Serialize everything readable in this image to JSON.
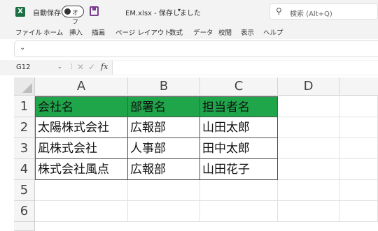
{
  "titlebar": {
    "app_icon": "excel-logo-icon",
    "app_icon_letter": "X",
    "autosave_label": "自動保存",
    "autosave_state": "オフ",
    "save_icon": "save-icon",
    "document_title": "EM.xlsx - 保存しました",
    "title_caret": "▾",
    "search_icon": "magnifier-icon",
    "search_glyph": "⚲",
    "search_placeholder": "検索 (Alt+Q)"
  },
  "menu": {
    "items": [
      "ファイル",
      "ホーム",
      "挿入",
      "描画",
      "ページ レイアウト",
      "数式",
      "データ",
      "校閲",
      "表示",
      "ヘルプ"
    ]
  },
  "ribbon": {
    "toggle_icon": "ribbon-expand-icon",
    "toggle_glyph": "⌄"
  },
  "formula_bar": {
    "name_box": "G12",
    "name_caret": "⌄",
    "separator": "⋮",
    "cancel_glyph": "✕",
    "enter_glyph": "✓",
    "fx_label": "fx",
    "value": ""
  },
  "grid": {
    "columns": [
      "A",
      "B",
      "C",
      "D"
    ],
    "rows": [
      "1",
      "2",
      "3",
      "4",
      "5",
      "6"
    ],
    "cells": [
      [
        "会社名",
        "部署名",
        "担当者名"
      ],
      [
        "太陽株式会社",
        "広報部",
        "山田太郎"
      ],
      [
        "凪株式会社",
        "人事部",
        "田中太郎"
      ],
      [
        "株式会社風点",
        "広報部",
        "山田花子"
      ]
    ],
    "header_fill": "#1fa54a"
  }
}
